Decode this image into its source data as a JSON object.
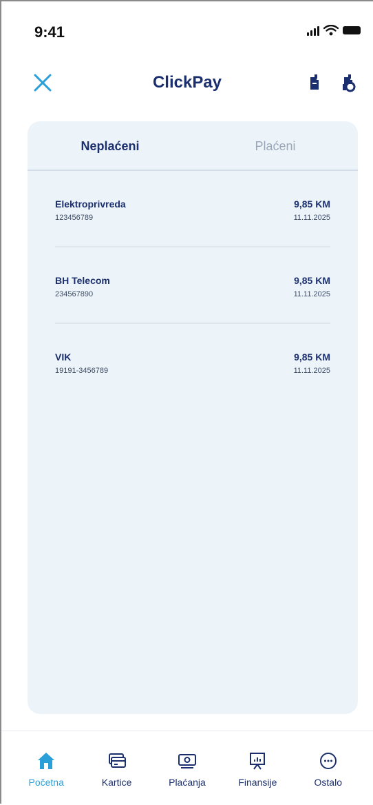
{
  "status_bar": {
    "time": "9:41"
  },
  "header": {
    "title": "ClickPay"
  },
  "tabs": [
    {
      "label": "Neplaćeni",
      "active": true
    },
    {
      "label": "Plaćeni",
      "active": false
    }
  ],
  "bills": [
    {
      "name": "Elektroprivreda",
      "ref": "123456789",
      "amount": "9,85 KM",
      "date": "11.11.2025"
    },
    {
      "name": "BH Telecom",
      "ref": "234567890",
      "amount": "9,85 KM",
      "date": "11.11.2025"
    },
    {
      "name": "VIK",
      "ref": "19191-3456789",
      "amount": "9,85 KM",
      "date": "11.11.2025"
    }
  ],
  "nav": [
    {
      "label": "Početna",
      "icon": "home-icon",
      "active": true
    },
    {
      "label": "Kartice",
      "icon": "cards-icon",
      "active": false
    },
    {
      "label": "Plaćanja",
      "icon": "payments-icon",
      "active": false
    },
    {
      "label": "Finansije",
      "icon": "finance-icon",
      "active": false
    },
    {
      "label": "Ostalo",
      "icon": "more-icon",
      "active": false
    }
  ],
  "colors": {
    "primary": "#1b2f6e",
    "accent": "#2a9fd8",
    "card_bg": "#edf4f9",
    "inactive_tab": "#9aa6b8"
  }
}
